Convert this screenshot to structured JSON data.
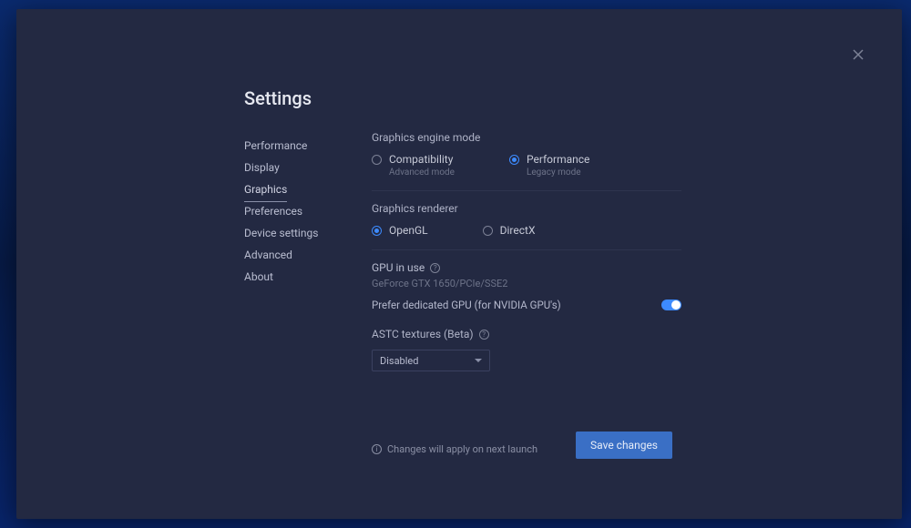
{
  "page_title": "Settings",
  "sidebar": {
    "items": [
      {
        "label": "Performance",
        "active": false
      },
      {
        "label": "Display",
        "active": false
      },
      {
        "label": "Graphics",
        "active": true
      },
      {
        "label": "Preferences",
        "active": false
      },
      {
        "label": "Device settings",
        "active": false
      },
      {
        "label": "Advanced",
        "active": false
      },
      {
        "label": "About",
        "active": false
      }
    ]
  },
  "graphics_engine": {
    "label": "Graphics engine mode",
    "options": [
      {
        "label": "Compatibility",
        "sublabel": "Advanced mode",
        "selected": false
      },
      {
        "label": "Performance",
        "sublabel": "Legacy mode",
        "selected": true
      }
    ]
  },
  "graphics_renderer": {
    "label": "Graphics renderer",
    "options": [
      {
        "label": "OpenGL",
        "selected": true
      },
      {
        "label": "DirectX",
        "selected": false
      }
    ]
  },
  "gpu": {
    "label": "GPU in use",
    "value": "GeForce GTX 1650/PCIe/SSE2",
    "prefer_dedicated_label": "Prefer dedicated GPU (for NVIDIA GPU's)",
    "prefer_dedicated_on": true
  },
  "astc": {
    "label": "ASTC textures (Beta)",
    "selected": "Disabled"
  },
  "footer": {
    "note": "Changes will apply on next launch",
    "save_label": "Save changes"
  }
}
